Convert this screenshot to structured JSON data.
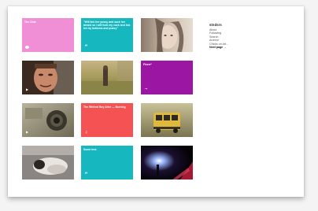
{
  "sidebar": {
    "title": "stndsrs",
    "links": [
      "About",
      "Following",
      "Search",
      "Archive",
      "Chicks on Art..."
    ],
    "next_page": "Next page →"
  },
  "tiles": [
    {
      "type": "chat",
      "color": "#f08ed6",
      "caption": "The Chat",
      "icon": "chat-bubble-icon"
    },
    {
      "type": "quote",
      "color": "#16b7be",
      "caption": "\"Will lick her pussy and suck her breast so i will fuck my cock and lick her by bottoms and pussy\"",
      "icon": "quote-icon"
    },
    {
      "type": "photo",
      "desc": "woman-portrait",
      "icon": ""
    },
    {
      "type": "video",
      "desc": "man-face",
      "icon": "play-icon"
    },
    {
      "type": "photo",
      "desc": "person-in-field",
      "icon": ""
    },
    {
      "type": "link",
      "color": "#9a16a3",
      "caption": "Fiverr*",
      "icon": "link-icon"
    },
    {
      "type": "video",
      "desc": "camera-closeup",
      "icon": "play-icon"
    },
    {
      "type": "audio",
      "color": "#f55353",
      "caption": "The Whiteal Boy Alive — Burning",
      "icon": "speaker-icon"
    },
    {
      "type": "photo",
      "desc": "school-bus",
      "icon": ""
    },
    {
      "type": "photo",
      "desc": "person-lying-down",
      "icon": ""
    },
    {
      "type": "text",
      "color": "#16b7be",
      "caption": "Some text.",
      "icon": "quote-icon"
    },
    {
      "type": "photo",
      "desc": "dark-concert-lights",
      "icon": ""
    }
  ]
}
